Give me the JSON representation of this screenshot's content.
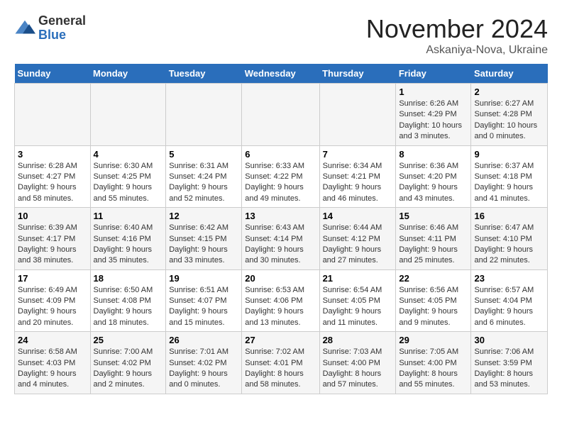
{
  "logo": {
    "line1": "General",
    "line2": "Blue"
  },
  "title": "November 2024",
  "location": "Askaniya-Nova, Ukraine",
  "weekdays": [
    "Sunday",
    "Monday",
    "Tuesday",
    "Wednesday",
    "Thursday",
    "Friday",
    "Saturday"
  ],
  "weeks": [
    [
      {
        "day": "",
        "info": ""
      },
      {
        "day": "",
        "info": ""
      },
      {
        "day": "",
        "info": ""
      },
      {
        "day": "",
        "info": ""
      },
      {
        "day": "",
        "info": ""
      },
      {
        "day": "1",
        "info": "Sunrise: 6:26 AM\nSunset: 4:29 PM\nDaylight: 10 hours\nand 3 minutes."
      },
      {
        "day": "2",
        "info": "Sunrise: 6:27 AM\nSunset: 4:28 PM\nDaylight: 10 hours\nand 0 minutes."
      }
    ],
    [
      {
        "day": "3",
        "info": "Sunrise: 6:28 AM\nSunset: 4:27 PM\nDaylight: 9 hours\nand 58 minutes."
      },
      {
        "day": "4",
        "info": "Sunrise: 6:30 AM\nSunset: 4:25 PM\nDaylight: 9 hours\nand 55 minutes."
      },
      {
        "day": "5",
        "info": "Sunrise: 6:31 AM\nSunset: 4:24 PM\nDaylight: 9 hours\nand 52 minutes."
      },
      {
        "day": "6",
        "info": "Sunrise: 6:33 AM\nSunset: 4:22 PM\nDaylight: 9 hours\nand 49 minutes."
      },
      {
        "day": "7",
        "info": "Sunrise: 6:34 AM\nSunset: 4:21 PM\nDaylight: 9 hours\nand 46 minutes."
      },
      {
        "day": "8",
        "info": "Sunrise: 6:36 AM\nSunset: 4:20 PM\nDaylight: 9 hours\nand 43 minutes."
      },
      {
        "day": "9",
        "info": "Sunrise: 6:37 AM\nSunset: 4:18 PM\nDaylight: 9 hours\nand 41 minutes."
      }
    ],
    [
      {
        "day": "10",
        "info": "Sunrise: 6:39 AM\nSunset: 4:17 PM\nDaylight: 9 hours\nand 38 minutes."
      },
      {
        "day": "11",
        "info": "Sunrise: 6:40 AM\nSunset: 4:16 PM\nDaylight: 9 hours\nand 35 minutes."
      },
      {
        "day": "12",
        "info": "Sunrise: 6:42 AM\nSunset: 4:15 PM\nDaylight: 9 hours\nand 33 minutes."
      },
      {
        "day": "13",
        "info": "Sunrise: 6:43 AM\nSunset: 4:14 PM\nDaylight: 9 hours\nand 30 minutes."
      },
      {
        "day": "14",
        "info": "Sunrise: 6:44 AM\nSunset: 4:12 PM\nDaylight: 9 hours\nand 27 minutes."
      },
      {
        "day": "15",
        "info": "Sunrise: 6:46 AM\nSunset: 4:11 PM\nDaylight: 9 hours\nand 25 minutes."
      },
      {
        "day": "16",
        "info": "Sunrise: 6:47 AM\nSunset: 4:10 PM\nDaylight: 9 hours\nand 22 minutes."
      }
    ],
    [
      {
        "day": "17",
        "info": "Sunrise: 6:49 AM\nSunset: 4:09 PM\nDaylight: 9 hours\nand 20 minutes."
      },
      {
        "day": "18",
        "info": "Sunrise: 6:50 AM\nSunset: 4:08 PM\nDaylight: 9 hours\nand 18 minutes."
      },
      {
        "day": "19",
        "info": "Sunrise: 6:51 AM\nSunset: 4:07 PM\nDaylight: 9 hours\nand 15 minutes."
      },
      {
        "day": "20",
        "info": "Sunrise: 6:53 AM\nSunset: 4:06 PM\nDaylight: 9 hours\nand 13 minutes."
      },
      {
        "day": "21",
        "info": "Sunrise: 6:54 AM\nSunset: 4:05 PM\nDaylight: 9 hours\nand 11 minutes."
      },
      {
        "day": "22",
        "info": "Sunrise: 6:56 AM\nSunset: 4:05 PM\nDaylight: 9 hours\nand 9 minutes."
      },
      {
        "day": "23",
        "info": "Sunrise: 6:57 AM\nSunset: 4:04 PM\nDaylight: 9 hours\nand 6 minutes."
      }
    ],
    [
      {
        "day": "24",
        "info": "Sunrise: 6:58 AM\nSunset: 4:03 PM\nDaylight: 9 hours\nand 4 minutes."
      },
      {
        "day": "25",
        "info": "Sunrise: 7:00 AM\nSunset: 4:02 PM\nDaylight: 9 hours\nand 2 minutes."
      },
      {
        "day": "26",
        "info": "Sunrise: 7:01 AM\nSunset: 4:02 PM\nDaylight: 9 hours\nand 0 minutes."
      },
      {
        "day": "27",
        "info": "Sunrise: 7:02 AM\nSunset: 4:01 PM\nDaylight: 8 hours\nand 58 minutes."
      },
      {
        "day": "28",
        "info": "Sunrise: 7:03 AM\nSunset: 4:00 PM\nDaylight: 8 hours\nand 57 minutes."
      },
      {
        "day": "29",
        "info": "Sunrise: 7:05 AM\nSunset: 4:00 PM\nDaylight: 8 hours\nand 55 minutes."
      },
      {
        "day": "30",
        "info": "Sunrise: 7:06 AM\nSunset: 3:59 PM\nDaylight: 8 hours\nand 53 minutes."
      }
    ]
  ]
}
